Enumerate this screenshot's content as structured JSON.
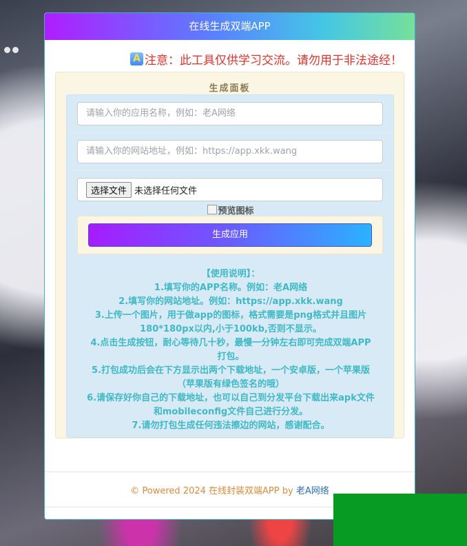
{
  "header": {
    "title": "在线生成双端APP"
  },
  "notice": {
    "badge": "A",
    "text": "注意：此工具仅供学习交流。请勿用于非法途经！"
  },
  "panel": {
    "title": "生成面板",
    "app_name_placeholder": "请输入你的应用名称，例如：老A网络",
    "url_placeholder": "请输入你的网站地址，例如：https://app.xkk.wang",
    "file_button": "选择文件",
    "file_status": "未选择任何文件",
    "preview_alt": "预览图标",
    "generate_button": "生成应用"
  },
  "instructions": [
    "【使用说明】：",
    "1.填写你的APP名称。例如：老A网络",
    "2.填写你的网站地址。例如：https://app.xkk.wang",
    "3.上传一个图片，用于做app的图标，格式需要是png格式并且图片",
    "180*180px以内,小于100kb,否则不显示。",
    "4.点击生成按钮，耐心等待几十秒，最慢一分钟左右即可完成双端APP",
    "打包。",
    "5.打包成功后会在下方显示出两个下载地址，一个安卓版，一个苹果版",
    "（苹果版有绿色签名的哦）",
    "6.请保存好你自己的下载地址，也可以自己到分发平台下载出来apk文件",
    "和mobileconfig文件自己进行分发。",
    "7.请勿打包生成任何违法擦边的网站，感谢配合。"
  ],
  "footer": {
    "text": "© Powered 2024 在线封装双端APP by ",
    "link": "老A网络"
  },
  "colors": {
    "notice": "#e4322b",
    "instructions": "#3fb9c5",
    "footer": "#e08a3b",
    "footer_link": "#2a6fb8",
    "green_block": "#079b23"
  }
}
